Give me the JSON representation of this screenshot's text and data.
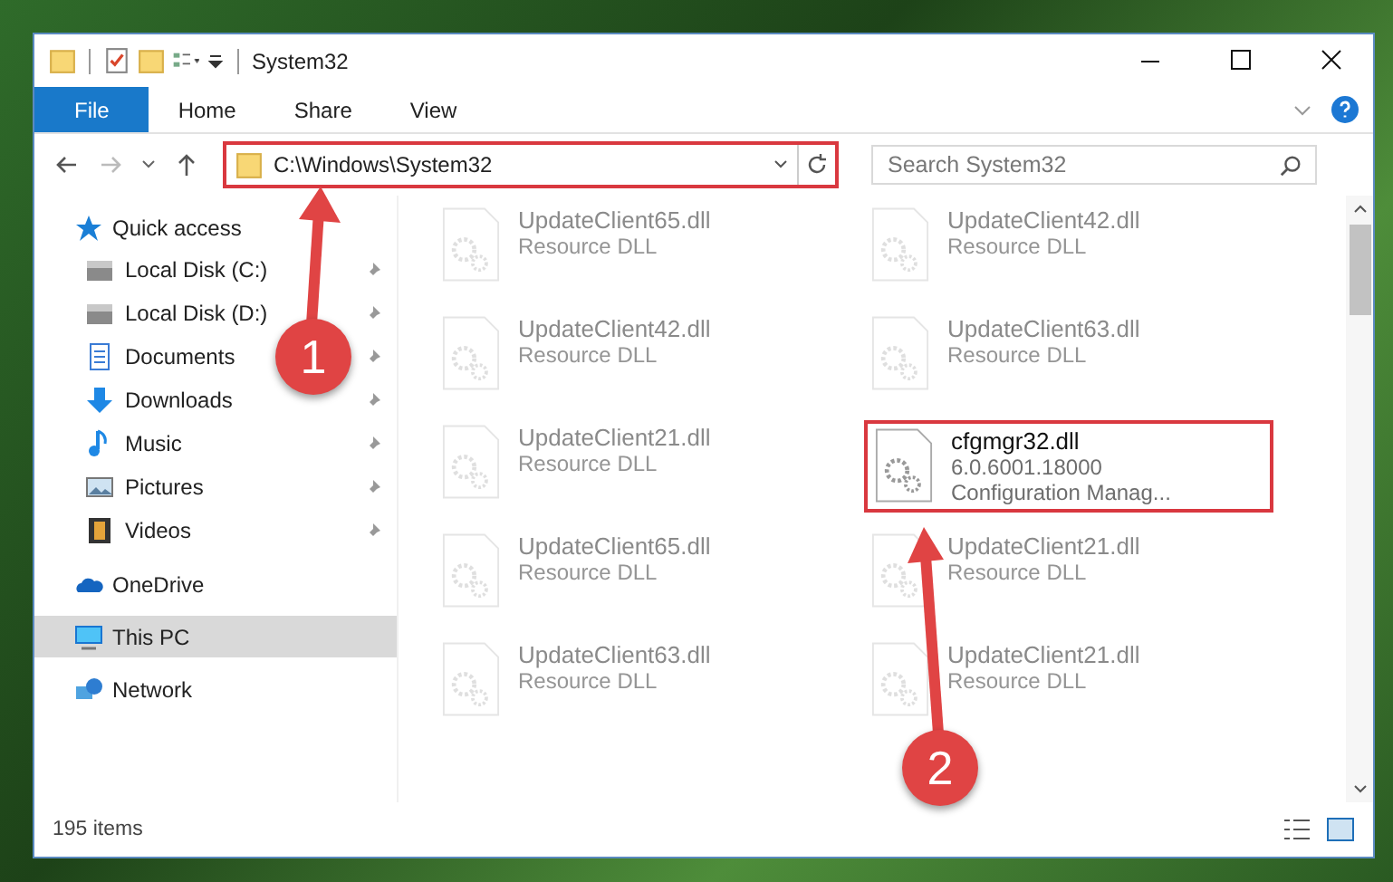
{
  "window": {
    "title": "System32"
  },
  "ribbon_tabs": [
    {
      "label": "File",
      "selected": true
    },
    {
      "label": "Home",
      "selected": false
    },
    {
      "label": "Share",
      "selected": false
    },
    {
      "label": "View",
      "selected": false
    }
  ],
  "address": {
    "value": "C:\\Windows\\System32",
    "highlighted": true
  },
  "search": {
    "placeholder": "Search System32"
  },
  "sidebar": {
    "sections": [
      {
        "label": "Quick access",
        "selected": false,
        "children": [
          {
            "label": "Local Disk (C:)",
            "pinned": true
          },
          {
            "label": "Local Disk (D:)",
            "pinned": true
          },
          {
            "label": "Documents",
            "pinned": true
          },
          {
            "label": "Downloads",
            "pinned": true
          },
          {
            "label": "Music",
            "pinned": true
          },
          {
            "label": "Pictures",
            "pinned": true
          },
          {
            "label": "Videos",
            "pinned": true
          }
        ]
      },
      {
        "label": "OneDrive",
        "selected": false
      },
      {
        "label": "This PC",
        "selected": true
      },
      {
        "label": "Network",
        "selected": false
      }
    ]
  },
  "files": [
    {
      "lines": [
        "UpdateClient65.dll",
        "Resource DLL"
      ],
      "faded": true,
      "highlighted": false
    },
    {
      "lines": [
        "UpdateClient42.dll",
        "Resource DLL"
      ],
      "faded": true,
      "highlighted": false
    },
    {
      "lines": [
        "UpdateClient42.dll",
        "Resource DLL"
      ],
      "faded": true,
      "highlighted": false
    },
    {
      "lines": [
        "UpdateClient63.dll",
        "Resource DLL"
      ],
      "faded": true,
      "highlighted": false
    },
    {
      "lines": [
        "UpdateClient21.dll",
        "Resource DLL"
      ],
      "faded": true,
      "highlighted": false
    },
    {
      "lines": [
        "cfgmgr32.dll",
        "6.0.6001.18000",
        "Configuration Manag..."
      ],
      "faded": false,
      "highlighted": true
    },
    {
      "lines": [
        "UpdateClient65.dll",
        "Resource DLL"
      ],
      "faded": true,
      "highlighted": false
    },
    {
      "lines": [
        "UpdateClient21.dll",
        "Resource DLL"
      ],
      "faded": true,
      "highlighted": false
    },
    {
      "lines": [
        "UpdateClient63.dll",
        "Resource DLL"
      ],
      "faded": true,
      "highlighted": false
    },
    {
      "lines": [
        "UpdateClient21.dll",
        "Resource DLL"
      ],
      "faded": true,
      "highlighted": false
    }
  ],
  "status_bar": {
    "count": "195 items"
  },
  "callouts": [
    {
      "label": "1"
    },
    {
      "label": "2"
    }
  ]
}
